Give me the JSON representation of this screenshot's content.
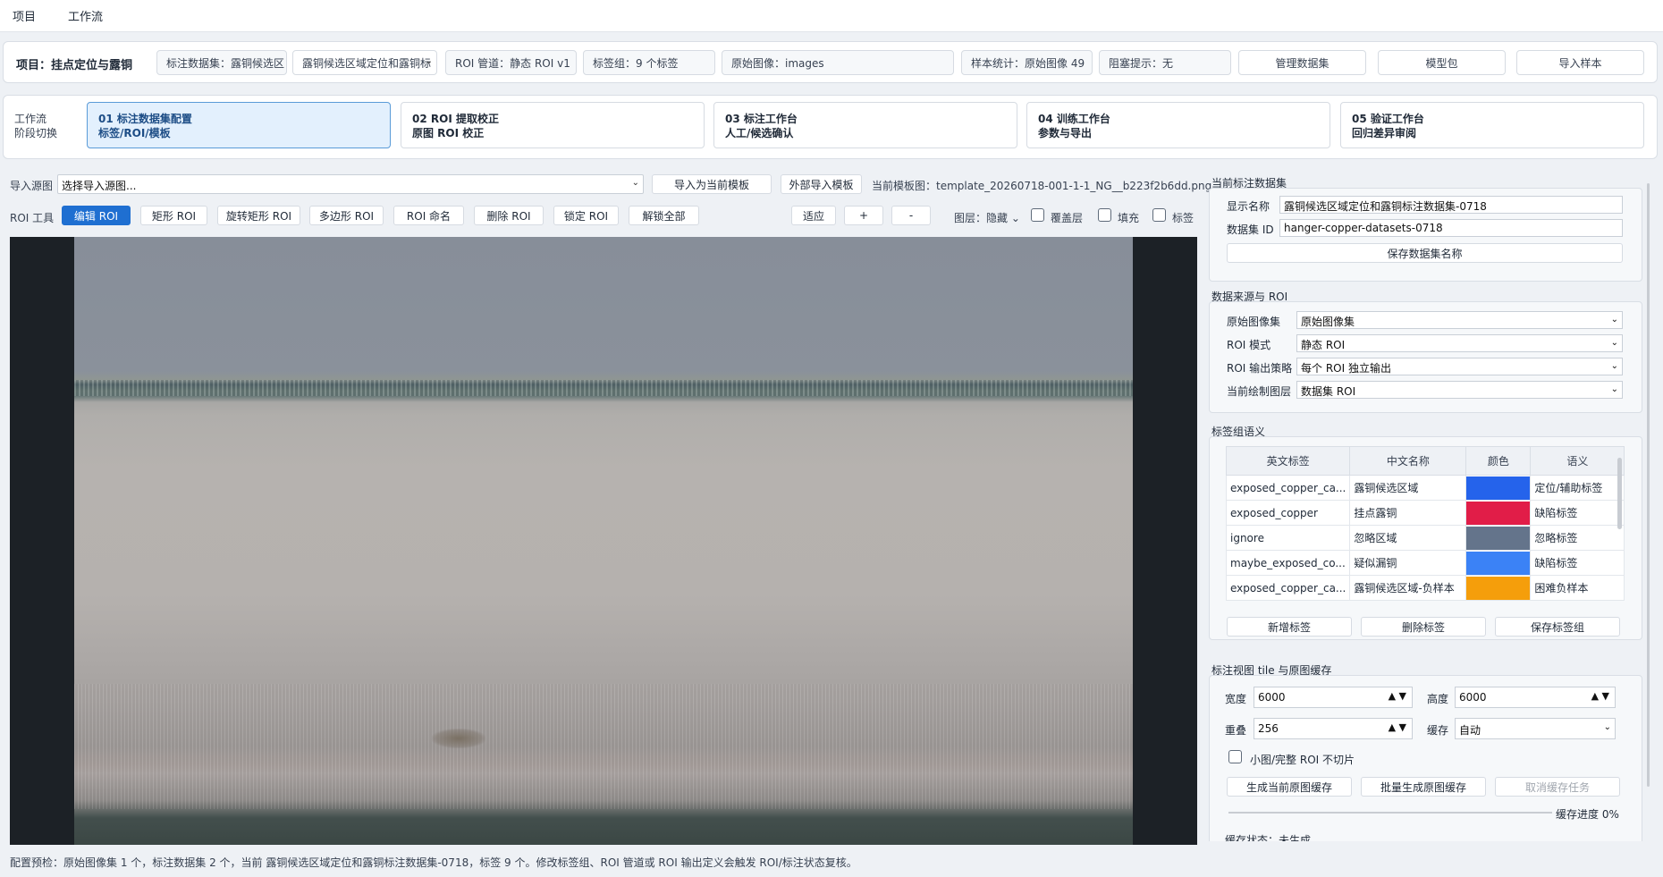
{
  "menu": {
    "items": [
      "项目",
      "工作流"
    ]
  },
  "project": {
    "title": "项目：挂点定位与露铜",
    "dataset_pill": "标注数据集：露铜候选区",
    "dataset_select": "露铜候选区域定位和露铜标",
    "roi_pipeline": "ROI 管道：静态 ROI v1",
    "label_group": "标签组：9 个标签",
    "raw_images": "原始图像：images",
    "sample_stats": "样本统计：原始图像 49",
    "blocker": "阻塞提示：无",
    "btn_manage": "管理数据集",
    "btn_model": "模型包",
    "btn_import": "导入样本"
  },
  "workflow": {
    "label_line1": "工作流",
    "label_line2": "阶段切换",
    "steps": [
      {
        "line1": "01   标注数据集配置",
        "line2": "标签/ROI/模板"
      },
      {
        "line1": "02   ROI 提取校正",
        "line2": "原图 ROI 校正"
      },
      {
        "line1": "03   标注工作台",
        "line2": "人工/候选确认"
      },
      {
        "line1": "04   训练工作台",
        "line2": "参数与导出"
      },
      {
        "line1": "05   验证工作台",
        "line2": "回归差异审阅"
      }
    ]
  },
  "toolbar": {
    "import_source_label": "导入源图",
    "import_source_placeholder": "选择导入源图...",
    "btn_import_template": "导入为当前模板",
    "btn_external_import": "外部导入模板",
    "current_template": "当前模板图：template_20260718-001-1-1_NG__b223f2b6dd.png",
    "roi_tool_label": "ROI 工具",
    "tools": [
      "编辑 ROI",
      "矩形 ROI",
      "旋转矩形 ROI",
      "多边形 ROI",
      "ROI 命名",
      "删除 ROI",
      "锁定 ROI",
      "解锁全部"
    ],
    "btn_fit": "适应",
    "btn_zoom_in": "+",
    "btn_zoom_out": "-",
    "layer_label": "图层：隐藏",
    "chk_overlay": "覆盖层",
    "chk_fill": "填充",
    "chk_label": "标签"
  },
  "status": "配置预检：原始图像集 1 个，标注数据集 2 个，当前 露铜候选区域定位和露铜标注数据集-0718，标签 9 个。修改标签组、ROI 管道或 ROI 输出定义会触发 ROI/标注状态复核。",
  "dataset_panel": {
    "title": "当前标注数据集",
    "display_name_label": "显示名称",
    "display_name": "露铜候选区域定位和露铜标注数据集-0718",
    "dataset_id_label": "数据集 ID",
    "dataset_id": "hanger-copper-datasets-0718",
    "btn_save_name": "保存数据集名称"
  },
  "source_panel": {
    "title": "数据来源与 ROI",
    "rows": [
      {
        "label": "原始图像集",
        "value": "原始图像集"
      },
      {
        "label": "ROI 模式",
        "value": "静态 ROI"
      },
      {
        "label": "ROI 输出策略",
        "value": "每个 ROI 独立输出"
      },
      {
        "label": "当前绘制图层",
        "value": "数据集 ROI"
      }
    ]
  },
  "label_panel": {
    "title": "标签组语义",
    "columns": [
      "英文标签",
      "中文名称",
      "颜色",
      "语义"
    ],
    "rows": [
      {
        "en": "exposed_copper_ca...",
        "zh": "露铜候选区域",
        "color": "#2563eb",
        "sem": "定位/辅助标签"
      },
      {
        "en": "exposed_copper",
        "zh": "挂点露铜",
        "color": "#e11d48",
        "sem": "缺陷标签"
      },
      {
        "en": "ignore",
        "zh": "忽略区域",
        "color": "#64748b",
        "sem": "忽略标签"
      },
      {
        "en": "maybe_exposed_co...",
        "zh": "疑似漏铜",
        "color": "#3b82f6",
        "sem": "缺陷标签"
      },
      {
        "en": "exposed_copper_ca...",
        "zh": "露铜候选区域-负样本",
        "color": "#f59e0b",
        "sem": "困难负样本"
      }
    ],
    "btn_add": "新增标签",
    "btn_delete": "删除标签",
    "btn_save": "保存标签组"
  },
  "tile_panel": {
    "title": "标注视图 tile 与原图缓存",
    "width_label": "宽度",
    "width": "6000",
    "height_label": "高度",
    "height": "6000",
    "overlap_label": "重叠",
    "overlap": "256",
    "cache_label": "缓存",
    "cache": "自动",
    "chk_small": "小图/完整 ROI 不切片",
    "btn_gen_current": "生成当前原图缓存",
    "btn_gen_batch": "批量生成原图缓存",
    "btn_cancel": "取消缓存任务",
    "progress_text": "缓存进度 0%",
    "progress": 0,
    "cache_status": "缓存状态：未生成"
  }
}
